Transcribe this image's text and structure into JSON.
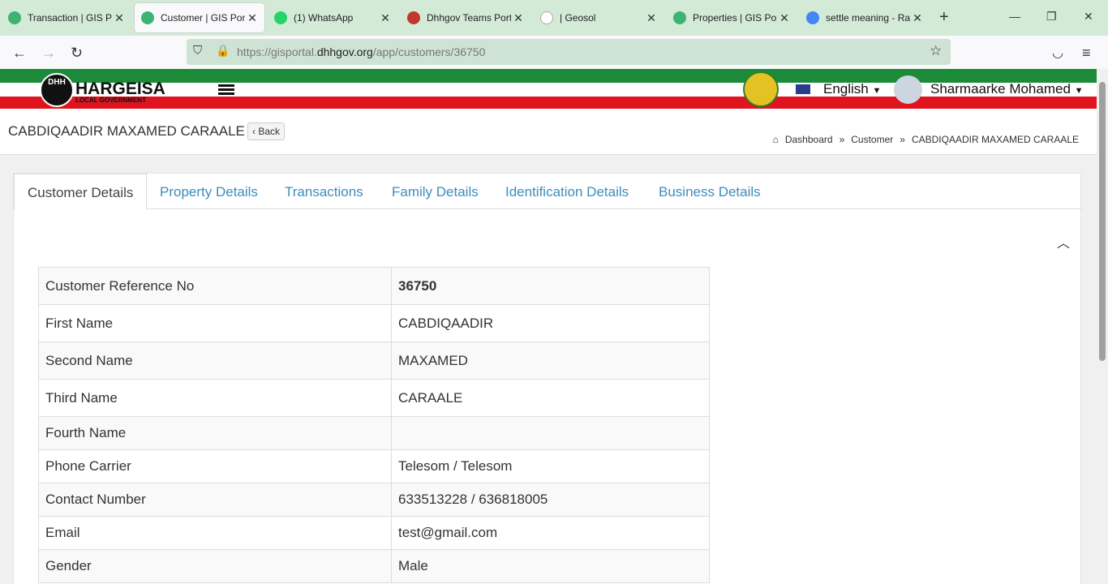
{
  "browser": {
    "tabs": [
      {
        "title": "Transaction | GIS Portal",
        "icon": "gis-favicon",
        "color": "#3cb371"
      },
      {
        "title": "Customer | GIS Portal",
        "icon": "gis-favicon",
        "color": "#3cb371"
      },
      {
        "title": "(1) WhatsApp",
        "icon": "whatsapp-favicon",
        "color": "#25d366"
      },
      {
        "title": "Dhhgov Teams Portal",
        "icon": "teams-favicon",
        "color": "#c0392b"
      },
      {
        "title": "| Geosol",
        "icon": "google-favicon",
        "color": "#ffffff"
      },
      {
        "title": "Properties | GIS Portal",
        "icon": "gis-favicon",
        "color": "#3cb371"
      },
      {
        "title": "settle meaning - Raadi",
        "icon": "google-favicon",
        "color": "#4285f4"
      }
    ],
    "url_prefix": "https://gisportal.",
    "url_domain": "dhhgov.org",
    "url_path": "/app/customers/36750"
  },
  "header": {
    "logo_badge": "DHH",
    "logo_title": "HARGEISA",
    "logo_subtitle": "LOCAL GOVERNMENT",
    "language": "English",
    "user_name": "Sharmaarke Mohamed"
  },
  "titlebar": {
    "title": "CABDIQAADIR MAXAMED CARAALE",
    "back_label": "Back",
    "breadcrumb": {
      "home": "Dashboard",
      "sep": "»",
      "section": "Customer",
      "current": "CABDIQAADIR MAXAMED CARAALE"
    }
  },
  "tabs": [
    {
      "label": "Customer Details",
      "active": true
    },
    {
      "label": "Property Details"
    },
    {
      "label": "Transactions"
    },
    {
      "label": "Family Details"
    },
    {
      "label": "Identification Details"
    },
    {
      "label": "Business Details"
    }
  ],
  "details": [
    {
      "label": "Customer Reference No",
      "value": "36750"
    },
    {
      "label": "First Name",
      "value": "CABDIQAADIR"
    },
    {
      "label": "Second Name",
      "value": "MAXAMED"
    },
    {
      "label": "Third Name",
      "value": "CARAALE"
    },
    {
      "label": "Fourth Name",
      "value": ""
    },
    {
      "label": "Phone Carrier",
      "value": "Telesom / Telesom"
    },
    {
      "label": "Contact Number",
      "value": "633513228 / 636818005"
    },
    {
      "label": "Email",
      "value": "test@gmail.com"
    },
    {
      "label": "Gender",
      "value": "Male"
    }
  ],
  "colors": {
    "accent": "#3c8dbc",
    "green": "#1b8b3a",
    "red": "#e0141e"
  }
}
